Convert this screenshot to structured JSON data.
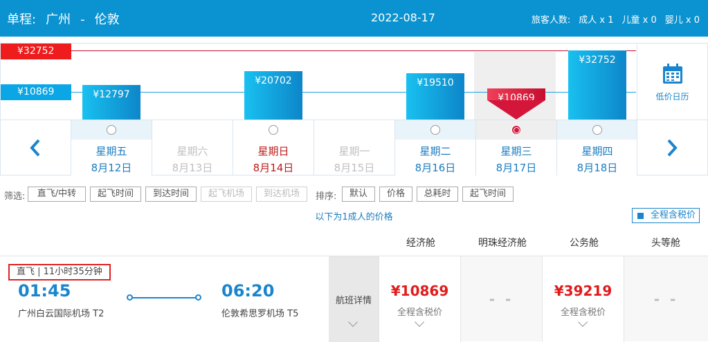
{
  "header": {
    "trip_type": "单程:",
    "from": "广州",
    "sep": "-",
    "to": "伦敦",
    "date": "2022-08-17",
    "pax_label": "旅客人数:",
    "adult": "成人 x 1",
    "child": "儿童 x 0",
    "infant": "婴儿 x 0"
  },
  "chart": {
    "max_tag": "¥32752",
    "min_tag": "¥10869",
    "calendar_label": "低价日历",
    "prev_icon": "chevron-left-icon",
    "next_icon": "chevron-right-icon",
    "days": [
      {
        "weekday": "星期五",
        "date": "8月12日",
        "price": "¥12797",
        "value": 12797,
        "state": "on"
      },
      {
        "weekday": "星期六",
        "date": "8月13日",
        "price": "",
        "value": null,
        "state": "off"
      },
      {
        "weekday": "星期日",
        "date": "8月14日",
        "price": "¥20702",
        "value": 20702,
        "state": "hol"
      },
      {
        "weekday": "星期一",
        "date": "8月15日",
        "price": "",
        "value": null,
        "state": "off"
      },
      {
        "weekday": "星期二",
        "date": "8月16日",
        "price": "¥19510",
        "value": 19510,
        "state": "on"
      },
      {
        "weekday": "星期三",
        "date": "8月17日",
        "price": "¥10869",
        "value": 10869,
        "state": "sel"
      },
      {
        "weekday": "星期四",
        "date": "8月18日",
        "price": "¥32752",
        "value": 32752,
        "state": "on"
      }
    ]
  },
  "filters": {
    "label": "筛选:",
    "items": [
      "直飞/中转",
      "起飞时间",
      "到达时间",
      "起飞机场",
      "到达机场"
    ],
    "sort_label": "排序:",
    "sort_items": [
      "默认",
      "价格",
      "总耗时",
      "起飞时间"
    ]
  },
  "note": "以下为1成人的价格",
  "tax_toggle": "全程含税价",
  "cabins": [
    "经济舱",
    "明珠经济舱",
    "公务舱",
    "头等舱"
  ],
  "flight": {
    "kind": "直飞 | 11小时35分钟",
    "dep_time": "01:45",
    "dep_airport": "广州白云国际机场 T2",
    "arr_time": "06:20",
    "arr_airport": "伦敦希思罗机场 T5",
    "detail_label": "航班详情",
    "fares": [
      {
        "price": "¥10869",
        "sub": "全程含税价",
        "available": true
      },
      {
        "price": "- -",
        "sub": "",
        "available": false
      },
      {
        "price": "¥39219",
        "sub": "全程含税价",
        "available": true
      },
      {
        "price": "- -",
        "sub": "",
        "available": false
      }
    ]
  }
}
